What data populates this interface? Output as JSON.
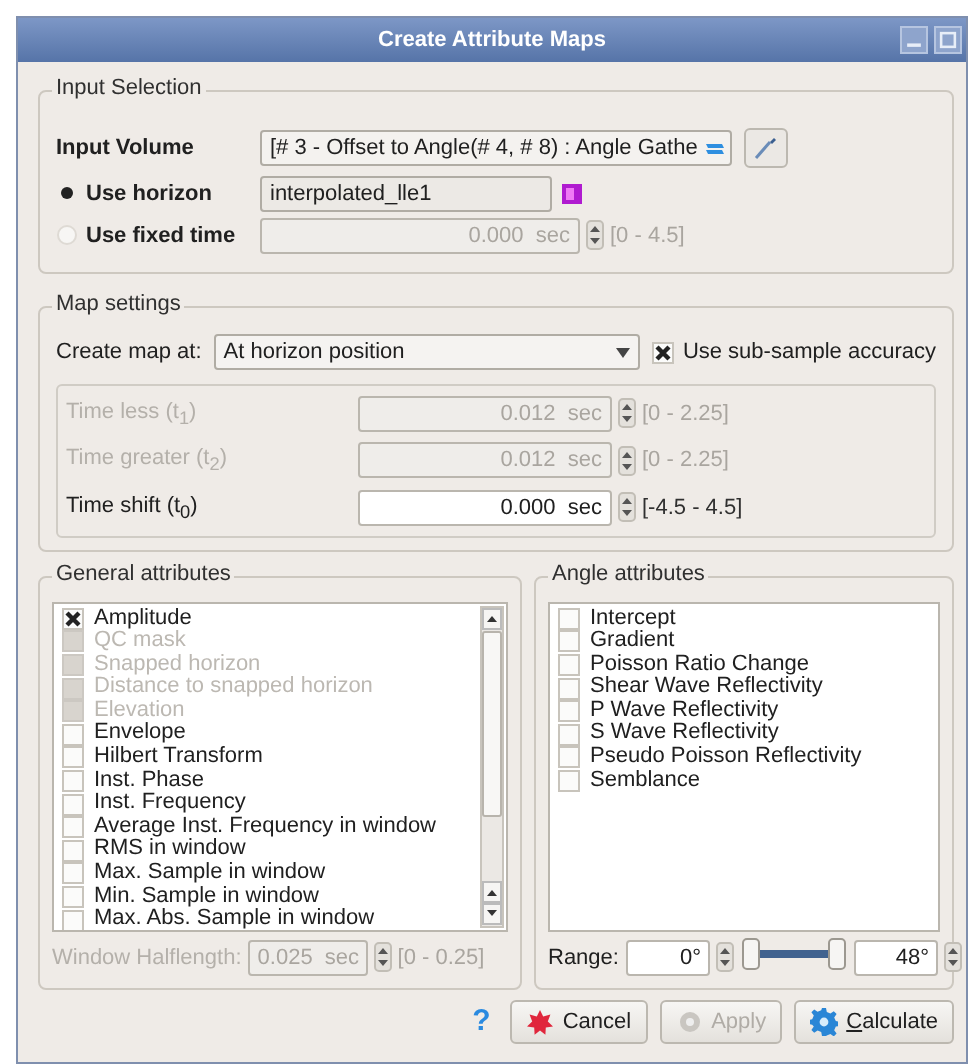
{
  "window": {
    "title": "Create Attribute Maps"
  },
  "input_selection": {
    "title": "Input Selection",
    "input_volume": {
      "label": "Input Volume",
      "value": "[# 3 - Offset to Angle(# 4, # 8) : Angle Gathe"
    },
    "sources": [
      {
        "label": "Use horizon",
        "selected": true,
        "kind": "horizon",
        "value": "interpolated_lle1"
      },
      {
        "label": "Use fixed time",
        "selected": false,
        "kind": "time",
        "disabled": true,
        "value": "0.000",
        "unit": "sec",
        "range": "[0 - 4.5]"
      }
    ]
  },
  "map_settings": {
    "title": "Map settings",
    "create_label": "Create map at:",
    "create_value": "At horizon position",
    "subsample": {
      "label": "Use sub-sample accuracy",
      "checked": true
    },
    "times": [
      {
        "label": "Time less (t$_{1}$)",
        "value": "0.012",
        "unit": "sec",
        "range": "[0 - 2.25]",
        "disabled": true
      },
      {
        "label": "Time greater (t$_{2}$)",
        "value": "0.012",
        "unit": "sec",
        "range": "[0 - 2.25]",
        "disabled": true
      },
      {
        "label": "Time shift (t$_{0}$)",
        "value": "0.000",
        "unit": "sec",
        "range": "[-4.5 - 4.5]",
        "disabled": false
      }
    ]
  },
  "general": {
    "title": "General attributes",
    "items": [
      {
        "label": "Amplitude",
        "checked": true,
        "disabled": false
      },
      {
        "label": "QC mask",
        "checked": false,
        "disabled": true
      },
      {
        "label": "Snapped horizon",
        "checked": false,
        "disabled": true
      },
      {
        "label": "Distance to snapped horizon",
        "checked": false,
        "disabled": true
      },
      {
        "label": "Elevation",
        "checked": false,
        "disabled": true
      },
      {
        "label": "Envelope",
        "checked": false,
        "disabled": false
      },
      {
        "label": "Hilbert Transform",
        "checked": false,
        "disabled": false
      },
      {
        "label": "Inst. Phase",
        "checked": false,
        "disabled": false
      },
      {
        "label": "Inst. Frequency",
        "checked": false,
        "disabled": false
      },
      {
        "label": "Average Inst. Frequency in window",
        "checked": false,
        "disabled": false
      },
      {
        "label": "RMS in window",
        "checked": false,
        "disabled": false
      },
      {
        "label": "Max. Sample in window",
        "checked": false,
        "disabled": false
      },
      {
        "label": "Min. Sample in window",
        "checked": false,
        "disabled": false
      },
      {
        "label": "Max. Abs. Sample in window",
        "checked": false,
        "disabled": false
      }
    ],
    "halflength": {
      "label": "Window Halflength:",
      "value": "0.025",
      "unit": "sec",
      "range": "[0 - 0.25]",
      "disabled": true
    }
  },
  "angle": {
    "title": "Angle attributes",
    "items": [
      {
        "label": "Intercept",
        "checked": false
      },
      {
        "label": "Gradient",
        "checked": false
      },
      {
        "label": "Poisson Ratio Change",
        "checked": false
      },
      {
        "label": "Shear Wave Reflectivity",
        "checked": false
      },
      {
        "label": "P Wave Reflectivity",
        "checked": false
      },
      {
        "label": "S Wave Reflectivity",
        "checked": false
      },
      {
        "label": "Pseudo Poisson Reflectivity",
        "checked": false
      },
      {
        "label": "Semblance",
        "checked": false
      }
    ],
    "range": {
      "label": "Range:",
      "min": "0°",
      "max": "48°"
    }
  },
  "help": "?",
  "buttons": [
    {
      "label": "Cancel",
      "kind": "cancel",
      "disabled": false
    },
    {
      "label": "Apply",
      "kind": "apply",
      "disabled": true
    },
    {
      "label": "Calculate",
      "kind": "calculate",
      "disabled": false
    }
  ]
}
